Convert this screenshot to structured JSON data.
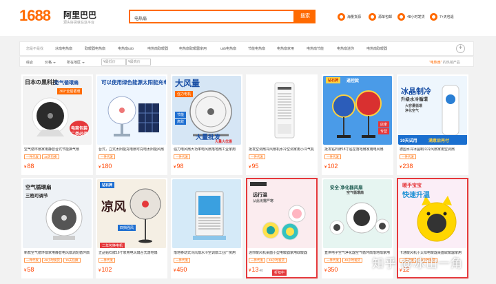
{
  "header": {
    "logo_num": "1688",
    "logo_cn": "阿里巴巴",
    "logo_sub": "源头好货就在这平台",
    "search_value": "电热扇",
    "search_btn": "搜索",
    "services": [
      "海量货源",
      "源单包邮",
      "48小时发货",
      "7+天包退"
    ]
  },
  "categories": {
    "label": "您是不是找",
    "items": [
      "冰扇电热扇",
      "取暖器电热扇",
      "电热扇usb",
      "电热扇取暖器",
      "电热扇取暖器家用",
      "usb电热扇",
      "节能电热扇",
      "电热扇家用",
      "电热扇节能",
      "电热扇迷你",
      "电热扇取暖器"
    ]
  },
  "filters": {
    "sort": "综合",
    "sales": "价格",
    "location": "所在地区",
    "price_from": "¥最低价",
    "price_to": "¥最高价",
    "hint_query": "“电热扇”",
    "hint_rest": "的热销产品"
  },
  "products": [
    {
      "title": "空气循环扇家用静音台式节能换气扇",
      "tags": [
        "一件代发",
        "15天包换"
      ],
      "price": "88",
      "overlay": [
        "日本の黒科技",
        "空气循環扇",
        "360°全屋循環",
        "电商包装",
        "二类必须"
      ]
    },
    {
      "title": "台式，立式太阳能充电扇可充电太阳能风扇",
      "tags": [
        "一件代发"
      ],
      "price": "180",
      "overlay": [
        "可以使用绿色能源太阳能充电"
      ]
    },
    {
      "title": "强力电风扇大功率电风扇落地扇工业家用",
      "tags": [
        "一件代发"
      ],
      "price": "98",
      "overlay": [
        "大风量",
        "节能",
        "高效",
        "强力电机",
        "大量批发",
        "大量大优惠"
      ]
    },
    {
      "title": "批发空调扇冷风扇机水冷空调家用小冷气机",
      "tags": [
        "一件代发"
      ],
      "price": "95",
      "overlay": []
    },
    {
      "title": "批发钻石牌18寸遥控落地扇家用电风扇",
      "tags": [
        "一件代发"
      ],
      "price": "102",
      "overlay": [
        "钻石牌",
        "遥控款",
        "店家",
        "专营"
      ]
    },
    {
      "title": "德国水冷冰晶制冷冷风扇家用空调扇",
      "tags": [
        "一件代发"
      ],
      "price": "238",
      "overlay": [
        "冰晶制冷",
        "升级水冷循環",
        "大容量循環",
        "净化空气",
        "30天试用",
        "满意后再付"
      ]
    },
    {
      "title": "新款空气循环扇家用静音电风扇涡轮循环扇",
      "tags": [
        "一件代发",
        "48小时发货",
        "15天包换"
      ],
      "price": "58",
      "overlay": [
        "空气循環扇",
        "三档可调节"
      ]
    },
    {
      "title": "正品钻石牌16寸家用电风扇台式落地扇",
      "tags": [
        "一件代发"
      ],
      "price": "102",
      "overlay": [
        "钻石牌",
        "凉风",
        "四挡强风",
        "二年包换电机"
      ]
    },
    {
      "title": "落地移动式冷风扇水冷空调扇工业厂房用",
      "tags": [
        "一件代发"
      ],
      "price": "450",
      "overlay": []
    },
    {
      "title": "迷你暖风机桌面小型电暖器家用取暖器",
      "tags": [
        "一件代发",
        "48小时发货"
      ],
      "price": "13",
      "price_extra": "40",
      "overlay": [
        "远行温",
        "从此无需严寒",
        "折扣中"
      ]
    },
    {
      "title": "直供电子空气净化器空气循环扇落地扇家用",
      "tags": [
        "一件代发",
        "48小时发货"
      ],
      "price": "350",
      "overlay": [
        "安全·净化器风扇",
        "空气循環扇"
      ]
    },
    {
      "title": "卡通暖风机小太阳电暖器桌面取暖器家用",
      "tags": [
        "一件代发",
        "48小时发货"
      ],
      "price": "12",
      "overlay": [
        "暖手宝宝",
        "快速升温"
      ]
    }
  ],
  "watermark": "知乎 @冰山一角"
}
